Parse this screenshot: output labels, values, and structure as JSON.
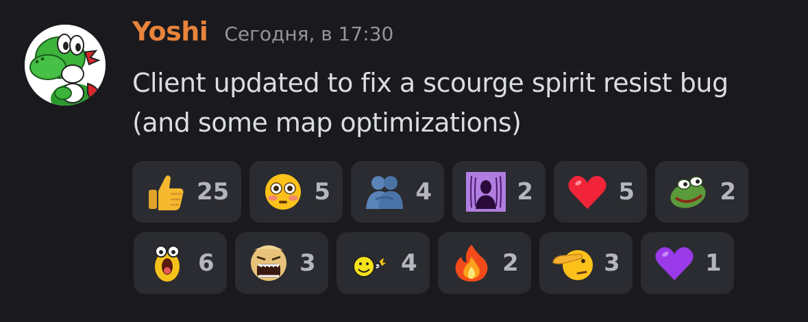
{
  "message": {
    "username": "Yoshi",
    "timestamp": "Сегодня, в 17:30",
    "text": "Client updated to fix a scourge spirit resist bug (and some map optimizations)",
    "avatar_icon": "yoshi-avatar-icon"
  },
  "colors": {
    "background": "#1a1a1e",
    "username": "#e8833a",
    "timestamp": "#94959c",
    "text": "#dbdee1",
    "reaction_bg": "#2b2c31",
    "reaction_count": "#b5b6bd"
  },
  "reactions": [
    {
      "icon": "thumbs-up-icon",
      "count": "25"
    },
    {
      "icon": "flushed-face-icon",
      "count": "5"
    },
    {
      "icon": "hugging-people-icon",
      "count": "4"
    },
    {
      "icon": "purple-ghost-icon",
      "count": "2"
    },
    {
      "icon": "red-heart-icon",
      "count": "5"
    },
    {
      "icon": "pepe-frog-icon",
      "count": "2"
    },
    {
      "icon": "screaming-egg-icon",
      "count": "6"
    },
    {
      "icon": "screaming-face-icon",
      "count": "3"
    },
    {
      "icon": "smiley-wave-icon",
      "count": "4"
    },
    {
      "icon": "fire-icon",
      "count": "2"
    },
    {
      "icon": "saluting-face-icon",
      "count": "3"
    },
    {
      "icon": "purple-heart-icon",
      "count": "1"
    }
  ]
}
